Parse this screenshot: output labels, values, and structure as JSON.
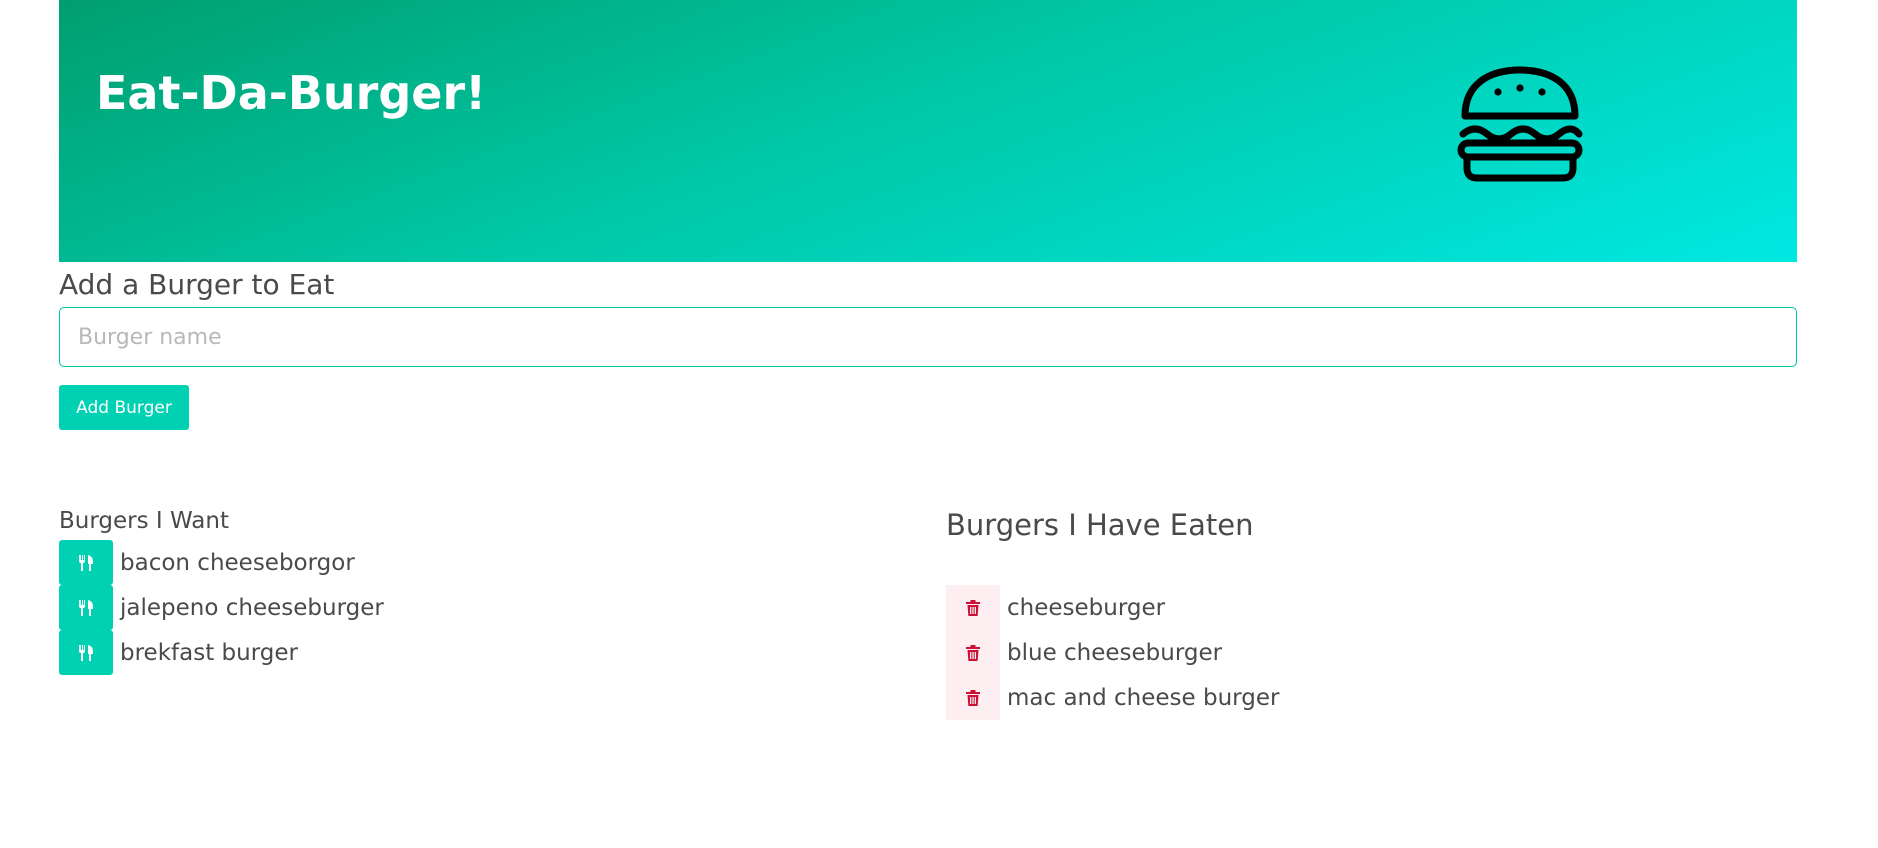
{
  "hero": {
    "title": "Eat-Da-Burger!",
    "logo_icon": "hamburger-icon"
  },
  "form": {
    "title": "Add a Burger to Eat",
    "input_value": "",
    "input_placeholder": "Burger name",
    "submit_label": "Add Burger"
  },
  "want": {
    "title": "Burgers I Want",
    "action_icon": "utensils-icon",
    "items": [
      {
        "name": "bacon cheeseborgor"
      },
      {
        "name": "jalepeno cheeseburger"
      },
      {
        "name": "brekfast burger"
      }
    ]
  },
  "eaten": {
    "title": "Burgers I Have Eaten",
    "action_icon": "trash-icon",
    "items": [
      {
        "name": "cheeseburger"
      },
      {
        "name": "blue cheeseburger"
      },
      {
        "name": "mac and cheese burger"
      }
    ]
  },
  "colors": {
    "primary": "#00d1b2",
    "hero_gradient_start": "#009e6f",
    "hero_gradient_end": "#00e8e3",
    "danger": "#cc0f35",
    "danger_light": "#fdeef1",
    "text": "#4a4a4a"
  }
}
